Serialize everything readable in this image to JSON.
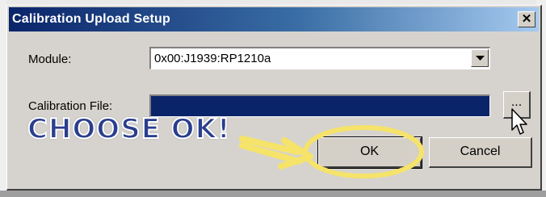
{
  "dialog": {
    "title": "Calibration Upload Setup",
    "close_label": "✕"
  },
  "form": {
    "module_label": "Module:",
    "module_value": "0x00:J1939:RP1210a",
    "file_label": "Calibration File:",
    "file_value": "",
    "browse_label": "..."
  },
  "buttons": {
    "ok": "OK",
    "cancel": "Cancel"
  },
  "annotation": {
    "text": "CHOOSE OK!",
    "highlight_color": "#f5e36a"
  }
}
